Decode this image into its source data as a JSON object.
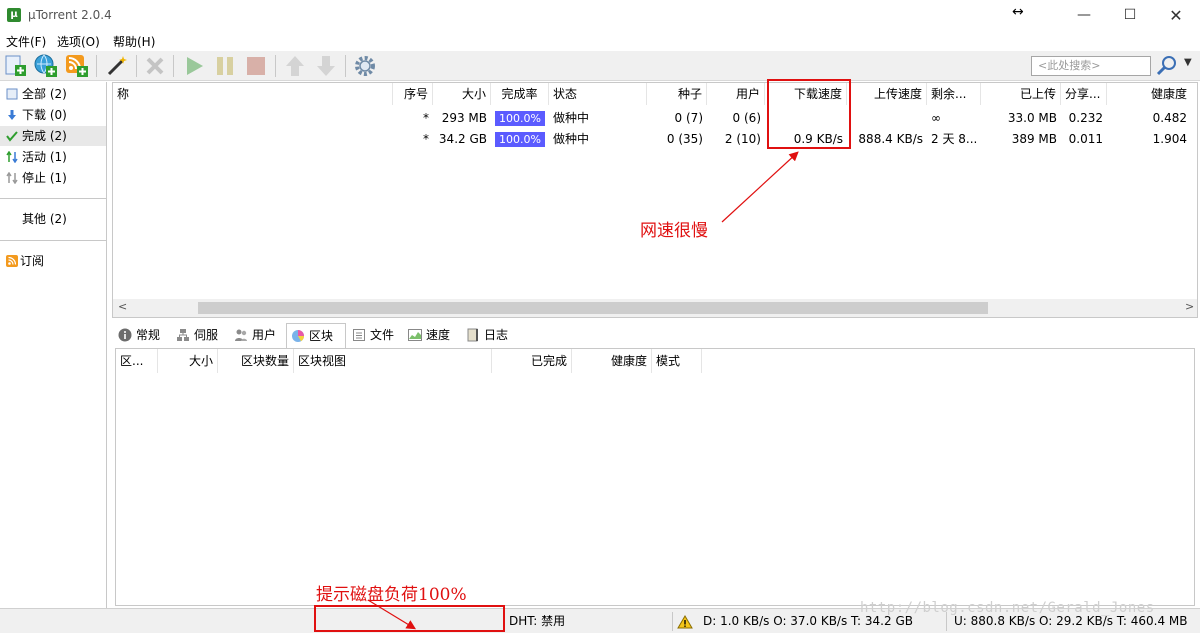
{
  "window": {
    "title": "µTorrent 2.0.4",
    "minimize": "—",
    "maximize": "☐",
    "close": "✕",
    "resize_arrow": "↔"
  },
  "menu": [
    "文件(F)",
    "选项(O)",
    "帮助(H)"
  ],
  "toolbar": {
    "search_placeholder": "<此处搜索>",
    "buttons": [
      "add-torrent-icon",
      "add-url-icon",
      "rss-icon",
      "create-torrent-icon",
      "remove-icon",
      "start-icon",
      "pause-icon",
      "stop-icon",
      "move-up-icon",
      "move-down-icon",
      "settings-icon"
    ]
  },
  "sidebar": {
    "items": [
      {
        "label": "全部 (2)",
        "icon": "all-icon"
      },
      {
        "label": "下载 (0)",
        "icon": "download-icon"
      },
      {
        "label": "完成 (2)",
        "icon": "check-icon"
      },
      {
        "label": "活动 (1)",
        "icon": "active-icon"
      },
      {
        "label": "停止 (1)",
        "icon": "stopped-icon"
      },
      {
        "label": "其他 (2)",
        "icon": ""
      },
      {
        "label": "订阅",
        "icon": "rss-icon"
      }
    ]
  },
  "list": {
    "columns": [
      "称",
      "序号",
      "大小",
      "完成率",
      "状态",
      "种子",
      "用户",
      "下载速度",
      "上传速度",
      "剩余...",
      "已上传",
      "分享...",
      "健康度"
    ],
    "rows": [
      {
        "queue": "*",
        "size": "293 MB",
        "done": "100.0%",
        "done_fraction": 1.0,
        "status": "做种中",
        "seeds": "0 (7)",
        "peers": "0 (6)",
        "down_speed": "",
        "up_speed": "",
        "eta": "∞",
        "uploaded": "33.0 MB",
        "ratio": "0.232",
        "health": "0.482"
      },
      {
        "queue": "*",
        "size": "34.2 GB",
        "done": "100.0%",
        "done_fraction": 1.0,
        "status": "做种中",
        "seeds": "0 (35)",
        "peers": "2 (10)",
        "down_speed": "0.9 KB/s",
        "up_speed": "888.4 KB/s",
        "eta": "2 天 8...",
        "uploaded": "389 MB",
        "ratio": "0.011",
        "health": "1.904"
      }
    ]
  },
  "tabs": [
    {
      "label": "常规",
      "icon": "info-icon"
    },
    {
      "label": "伺服",
      "icon": "tracker-icon"
    },
    {
      "label": "用户",
      "icon": "peers-icon"
    },
    {
      "label": "区块",
      "icon": "pieces-icon",
      "active": true
    },
    {
      "label": "文件",
      "icon": "files-icon"
    },
    {
      "label": "速度",
      "icon": "speed-icon"
    },
    {
      "label": "日志",
      "icon": "log-icon"
    }
  ],
  "detail": {
    "columns": [
      "区...",
      "大小",
      "区块数量",
      "区块视图",
      "已完成",
      "健康度",
      "模式"
    ]
  },
  "statusbar": {
    "dht": "DHT: 禁用",
    "down": "D: 1.0 KB/s O: 37.0 KB/s T: 34.2 GB",
    "up": "U: 880.8 KB/s O: 29.2 KB/s T: 460.4 MB"
  },
  "annotations": {
    "speed_note": "网速很慢",
    "disk_note": "提示磁盘负荷100%"
  },
  "watermark": "http://blog.csdn.net/Gerald_Jones",
  "colors": {
    "annotation": "#e01010",
    "progress": "#5b5bff"
  }
}
